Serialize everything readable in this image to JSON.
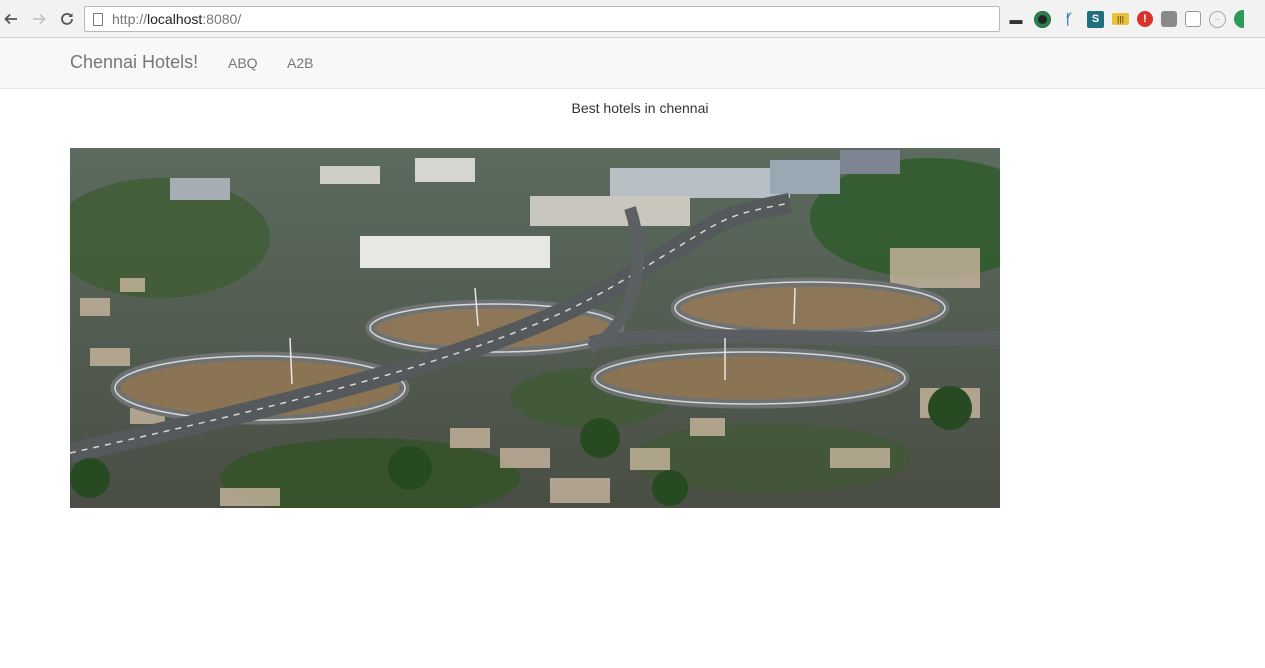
{
  "browser": {
    "url_scheme": "http://",
    "url_host": "localhost",
    "url_port": ":8080/",
    "extensions": [
      "glasses-icon",
      "color-wheel-icon",
      "bluetooth-icon",
      "s-extension-icon",
      "ruler-icon",
      "alert-icon",
      "puzzle-icon",
      "square-icon",
      "dots-icon",
      "green-extension-icon"
    ]
  },
  "navbar": {
    "brand": "Chennai Hotels!",
    "links": [
      "ABQ",
      "A2B"
    ]
  },
  "main": {
    "tagline": "Best hotels in chennai",
    "hero_image": "aerial-flyover-photo"
  }
}
